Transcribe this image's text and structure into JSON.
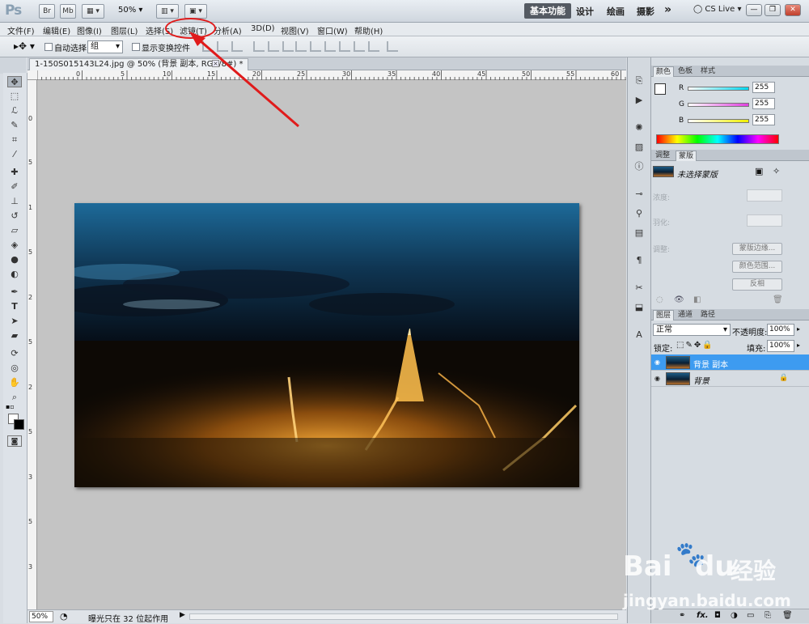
{
  "app": {
    "logo": "Ps",
    "bridge_btn": "Br",
    "minibridge_btn": "Mb",
    "zoom": "50%",
    "workspaces": {
      "active": "基本功能",
      "items": [
        "设计",
        "绘画",
        "摄影"
      ],
      "more": "»"
    },
    "cs_live": "CS Live",
    "window_controls": [
      "—",
      "❐",
      "✕"
    ]
  },
  "menu": [
    "文件(F)",
    "编辑(E)",
    "图像(I)",
    "图层(L)",
    "选择(S)",
    "滤镜(T)",
    "分析(A)",
    "3D(D)",
    "视图(V)",
    "窗口(W)",
    "帮助(H)"
  ],
  "options": {
    "auto_select_label": "自动选择:",
    "auto_select_target": "组",
    "show_transform_label": "显示变换控件"
  },
  "document": {
    "tab_title": "1-150S015143L24.jpg @ 50% (背景 副本, RGB/8#) *",
    "ruler_h_ticks": [
      "0",
      "5",
      "10",
      "15",
      "20",
      "25",
      "30",
      "35",
      "40",
      "45",
      "50",
      "55",
      "60"
    ],
    "ruler_v_ticks": [
      "0",
      "5",
      "1",
      "5",
      "2",
      "5",
      "2",
      "5",
      "3",
      "5",
      "3"
    ],
    "status_zoom": "50%",
    "status_text": "曝光只在 32 位起作用"
  },
  "color_panel": {
    "tabs": [
      "颜色",
      "色板",
      "样式"
    ],
    "channels": [
      {
        "label": "R",
        "value": "255",
        "color": "#00d8f0"
      },
      {
        "label": "G",
        "value": "255",
        "color": "#e040e0"
      },
      {
        "label": "B",
        "value": "255",
        "color": "#f0f000"
      }
    ]
  },
  "masks_panel": {
    "tabs": [
      "调整",
      "蒙版"
    ],
    "title": "未选择蒙版",
    "density_label": "浓度:",
    "feather_label": "羽化:",
    "refine_label": "调整:",
    "buttons": [
      "蒙版边缘...",
      "颜色范围...",
      "反相"
    ]
  },
  "layers_panel": {
    "tabs": [
      "图层",
      "通道",
      "路径"
    ],
    "blend_mode": "正常",
    "opacity_label": "不透明度:",
    "opacity_value": "100%",
    "lock_label": "锁定:",
    "fill_label": "填充:",
    "fill_value": "100%",
    "layers": [
      {
        "name": "背景 副本",
        "selected": true
      },
      {
        "name": "背景",
        "selected": false
      }
    ],
    "footer_icons": [
      "link-icon",
      "fx-icon",
      "mask-icon",
      "adjustment-icon",
      "group-icon",
      "new-layer-icon",
      "trash-icon"
    ],
    "fx_label": "fx."
  },
  "watermark": {
    "brand": "Bai",
    "brand2": "du",
    "text": "经验",
    "url": "jingyan.baidu.com"
  },
  "colors": {
    "annotation": "#e01b1b",
    "selected_layer": "#3d9bf0"
  }
}
